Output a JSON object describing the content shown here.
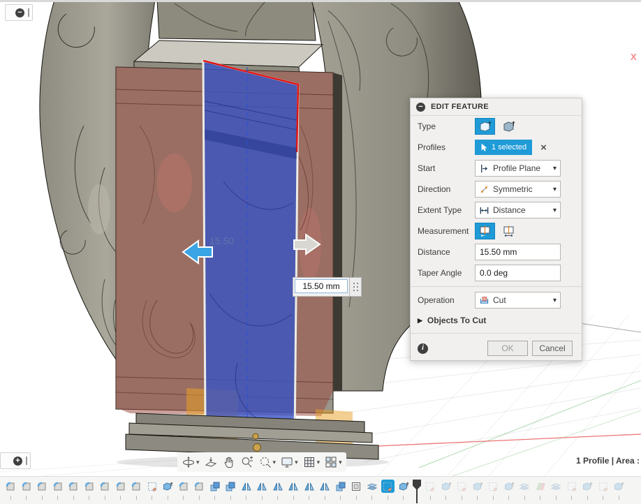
{
  "app": {
    "axis_label": "X",
    "status_text": "1 Profile | Area :"
  },
  "canvas": {
    "dimension_label": "15.50",
    "floating_input_value": "15.50 mm"
  },
  "dialog": {
    "title": "EDIT FEATURE",
    "fields": {
      "type": {
        "label": "Type"
      },
      "profiles": {
        "label": "Profiles",
        "value": "1 selected"
      },
      "start": {
        "label": "Start",
        "value": "Profile Plane"
      },
      "direction": {
        "label": "Direction",
        "value": "Symmetric"
      },
      "extent": {
        "label": "Extent Type",
        "value": "Distance"
      },
      "measurement": {
        "label": "Measurement"
      },
      "distance": {
        "label": "Distance",
        "value": "15.50 mm"
      },
      "taper": {
        "label": "Taper Angle",
        "value": "0.0 deg"
      },
      "operation": {
        "label": "Operation",
        "value": "Cut"
      }
    },
    "objects_to_cut_label": "Objects To Cut",
    "ok_label": "OK",
    "cancel_label": "Cancel"
  },
  "nav_toolbar": {
    "items": [
      {
        "name": "orbit",
        "caret": true
      },
      {
        "name": "look-at",
        "caret": false
      },
      {
        "name": "pan",
        "caret": false
      },
      {
        "name": "zoom",
        "caret": false
      },
      {
        "name": "fit",
        "caret": true
      },
      {
        "name": "display-settings",
        "caret": true
      },
      {
        "name": "grid",
        "caret": true
      },
      {
        "name": "viewports",
        "caret": true
      }
    ]
  },
  "timeline": {
    "playhead_after": 26,
    "items": [
      {
        "type": "fillet",
        "state": "done"
      },
      {
        "type": "fillet",
        "state": "done"
      },
      {
        "type": "fillet",
        "state": "done"
      },
      {
        "type": "fillet",
        "state": "done"
      },
      {
        "type": "fillet",
        "state": "done"
      },
      {
        "type": "fillet",
        "state": "done"
      },
      {
        "type": "fillet",
        "state": "done"
      },
      {
        "type": "fillet",
        "state": "done"
      },
      {
        "type": "fillet",
        "state": "done"
      },
      {
        "type": "sketch",
        "state": "done"
      },
      {
        "type": "extrude",
        "state": "done"
      },
      {
        "type": "fillet",
        "state": "done"
      },
      {
        "type": "fillet",
        "state": "done"
      },
      {
        "type": "combine",
        "state": "done"
      },
      {
        "type": "combine",
        "state": "done"
      },
      {
        "type": "mirror",
        "state": "done"
      },
      {
        "type": "mirror",
        "state": "done"
      },
      {
        "type": "mirror",
        "state": "done"
      },
      {
        "type": "mirror",
        "state": "done"
      },
      {
        "type": "mirror",
        "state": "done"
      },
      {
        "type": "mirror",
        "state": "done"
      },
      {
        "type": "combine",
        "state": "done"
      },
      {
        "type": "rect-pattern",
        "state": "done"
      },
      {
        "type": "split",
        "state": "done"
      },
      {
        "type": "sketch",
        "state": "selected"
      },
      {
        "type": "extrude",
        "state": "done"
      },
      {
        "type": "sketch",
        "state": "pending"
      },
      {
        "type": "extrude",
        "state": "pending"
      },
      {
        "type": "sketch",
        "state": "pending"
      },
      {
        "type": "extrude",
        "state": "pending"
      },
      {
        "type": "sketch",
        "state": "pending"
      },
      {
        "type": "extrude",
        "state": "pending"
      },
      {
        "type": "split",
        "state": "pending"
      },
      {
        "type": "planes",
        "state": "pending"
      },
      {
        "type": "split",
        "state": "pending"
      },
      {
        "type": "sketch",
        "state": "pending"
      },
      {
        "type": "extrude",
        "state": "pending"
      },
      {
        "type": "sketch",
        "state": "pending"
      },
      {
        "type": "extrude",
        "state": "pending"
      }
    ]
  },
  "colors": {
    "accent_blue": "#1f9bd7",
    "profile_outline_red": "#e01515",
    "preview_blue": "#3b54c4",
    "highlight_red_overlay": "#9e4a40",
    "highlight_orange": "#e8a026",
    "axis_label_red": "#f38a8a"
  }
}
